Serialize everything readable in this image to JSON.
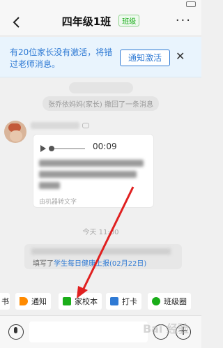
{
  "header": {
    "title": "四年级1班",
    "badge": "班级",
    "more": "···"
  },
  "notice": {
    "text": "有20位家长没有激活，将错过老师消息。",
    "button_label": "通知激活",
    "close": "✕"
  },
  "messages": {
    "withdrawn": "张乔依妈妈(家长) 撤回了一条消息",
    "voice_duration": "00:09",
    "machine_label": "由机器转文字",
    "time": "今天 11:00",
    "card_prefix": "填写了",
    "card_link": "学生每日健康上报(02月22日)"
  },
  "toolbar": {
    "items": [
      {
        "label": "通知",
        "icon": "megaphone-icon",
        "color": "#ff8a00"
      },
      {
        "label": "家校本",
        "icon": "book-icon",
        "color": "#1aad19"
      },
      {
        "label": "打卡",
        "icon": "checkbox-icon",
        "color": "#2f7ad4"
      },
      {
        "label": "班级圈",
        "icon": "circle-icon",
        "color": "#1aad19"
      }
    ],
    "partial_left": "书"
  },
  "watermark": "Bai 经验",
  "colors": {
    "accent": "#2f7ad4",
    "green": "#1aad19",
    "arrow": "#e02020"
  }
}
